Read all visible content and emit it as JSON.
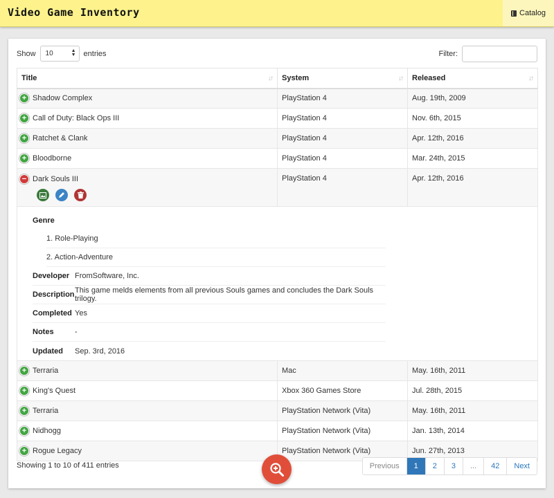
{
  "app": {
    "title": "Video Game Inventory",
    "nav_catalog": "Catalog"
  },
  "controls": {
    "show_label": "Show",
    "entries_label": "entries",
    "page_size": "10",
    "filter_label": "Filter:",
    "filter_value": ""
  },
  "table": {
    "columns": [
      "Title",
      "System",
      "Released"
    ],
    "rows": [
      {
        "title": "Shadow Complex",
        "system": "PlayStation 4",
        "released": "Aug. 19th, 2009"
      },
      {
        "title": "Call of Duty: Black Ops III",
        "system": "PlayStation 4",
        "released": "Nov. 6th, 2015"
      },
      {
        "title": "Ratchet & Clank",
        "system": "PlayStation 4",
        "released": "Apr. 12th, 2016"
      },
      {
        "title": "Bloodborne",
        "system": "PlayStation 4",
        "released": "Mar. 24th, 2015"
      },
      {
        "title": "Dark Souls III",
        "system": "PlayStation 4",
        "released": "Apr. 12th, 2016"
      },
      {
        "title": "Terraria",
        "system": "Mac",
        "released": "May. 16th, 2011"
      },
      {
        "title": "King's Quest",
        "system": "Xbox 360 Games Store",
        "released": "Jul. 28th, 2015"
      },
      {
        "title": "Terraria",
        "system": "PlayStation Network (Vita)",
        "released": "May. 16th, 2011"
      },
      {
        "title": "Nidhogg",
        "system": "PlayStation Network (Vita)",
        "released": "Jan. 13th, 2014"
      },
      {
        "title": "Rogue Legacy",
        "system": "PlayStation Network (Vita)",
        "released": "Jun. 27th, 2013"
      }
    ]
  },
  "detail": {
    "genre_label": "Genre",
    "genres": [
      "1. Role-Playing",
      "2. Action-Adventure"
    ],
    "developer_label": "Developer",
    "developer": "FromSoftware, Inc.",
    "description_label": "Description",
    "description": "This game melds elements from all previous Souls games and concludes the Dark Souls trilogy.",
    "completed_label": "Completed",
    "completed": "Yes",
    "notes_label": "Notes",
    "notes": "-",
    "updated_label": "Updated",
    "updated": "Sep. 3rd, 2016"
  },
  "footer": {
    "info": "Showing 1 to 10 of 411 entries",
    "pager": {
      "previous": "Previous",
      "pages": [
        "1",
        "2",
        "3",
        "...",
        "42"
      ],
      "next": "Next"
    }
  },
  "colors": {
    "header_bg": "#fdf28c",
    "accent": "#2f77b8",
    "fab": "#e04e3a",
    "expand": "#41a541",
    "collapse": "#d13a3a"
  },
  "icons": [
    "book-icon",
    "sort-icon",
    "expand-icon",
    "collapse-icon",
    "image-icon",
    "pencil-icon",
    "trash-icon",
    "zoom-in-icon"
  ]
}
